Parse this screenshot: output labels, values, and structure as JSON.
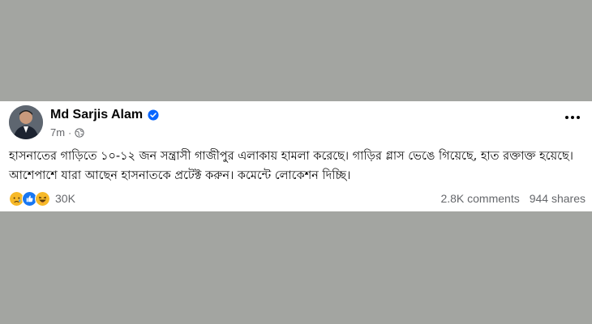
{
  "post": {
    "author": "Md Sarjis Alam",
    "time": "7m",
    "time_separator": "·",
    "text": "হাসনাতের গাড়িতে ১০-১২ জন সন্ত্রাসী গাজীপুর এলাকায় হামলা করেছে। গাড়ির গ্লাস ভেঙে গিয়েছে, হাত রক্তাক্ত হয়েছে। আশেপাশে যারা আছেন হাসনাতকে প্রটেক্ট করুন। কমেন্টে লোকেশন দিচ্ছি।",
    "reaction_count": "30K",
    "comments": "2.8K comments",
    "shares": "944 shares"
  },
  "icons": {
    "verified": "verified-badge-icon",
    "audience": "globe-icon",
    "more": "more-options-icon",
    "reactions": [
      "sad-reaction-icon",
      "like-reaction-icon",
      "haha-reaction-icon"
    ]
  },
  "colors": {
    "verified": "#0866ff",
    "like": "#1877f2",
    "reaction_yellow": "#f7b928",
    "secondary_text": "#65676b"
  }
}
